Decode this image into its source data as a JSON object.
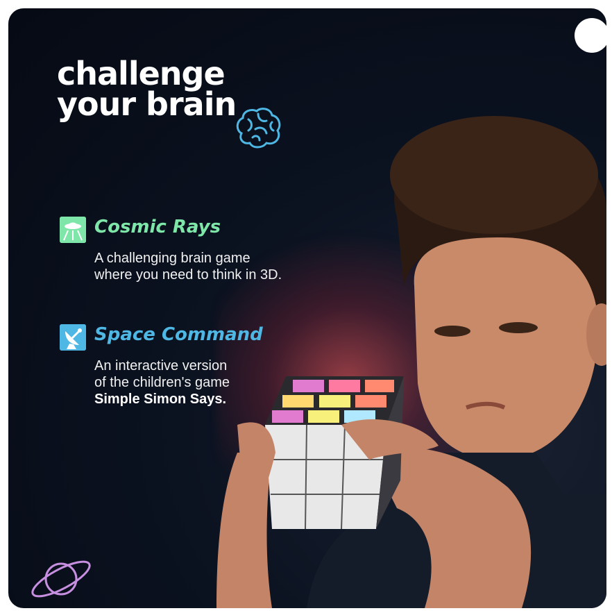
{
  "title": {
    "line1": "challenge",
    "line2": "your brain"
  },
  "features": [
    {
      "heading": "Cosmic Rays",
      "desc_line1": "A challenging brain game",
      "desc_line2": "where you need to think in 3D.",
      "icon": "ufo-icon",
      "color": "#7ee6a8"
    },
    {
      "heading": "Space Command",
      "desc_line1": "An interactive version",
      "desc_line2": "of the children's game",
      "desc_bold": "Simple Simon Says.",
      "icon": "satellite-dish-icon",
      "color": "#4fb7e4"
    }
  ],
  "decor": {
    "brain_icon": "brain-icon",
    "planet_icon": "planet-icon",
    "brain_color": "#4fb7e4",
    "planet_color": "#c78fe0"
  }
}
